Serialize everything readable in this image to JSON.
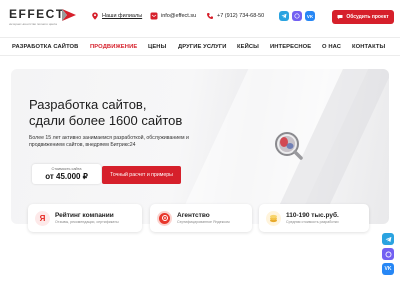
{
  "header": {
    "logo_text": "EFFECT",
    "logo_tagline": "интернет-агентство полного цикла",
    "filials_label": "Наши филиалы",
    "email": "info@effect.su",
    "phone": "+7 (912) 734-68-50",
    "discuss_label": "Обсудить проект",
    "socials": [
      "telegram-icon",
      "viber-icon",
      "vk-icon"
    ]
  },
  "nav": {
    "items": [
      {
        "label": "РАЗРАБОТКА САЙТОВ",
        "active": false
      },
      {
        "label": "ПРОДВИЖЕНИЕ",
        "active": true
      },
      {
        "label": "ЦЕНЫ",
        "active": false
      },
      {
        "label": "ДРУГИЕ УСЛУГИ",
        "active": false
      },
      {
        "label": "КЕЙСЫ",
        "active": false
      },
      {
        "label": "ИНТЕРЕСНОЕ",
        "active": false
      },
      {
        "label": "О НАС",
        "active": false
      },
      {
        "label": "КОНТАКТЫ",
        "active": false
      }
    ]
  },
  "hero": {
    "title_line1": "Разработка сайтов,",
    "title_line2": "сдали более 1600 сайтов",
    "description": "Более 15 лет активно занимаемся разработкой, обслуживанием и продвижением сайтов, внедряем Битрикс24",
    "price_caption": "Стоимость сайта",
    "price_value": "от 45.000 ₽",
    "calc_button": "Точный расчет и примеры"
  },
  "features": [
    {
      "title": "Рейтинг компании",
      "subtitle": "Отзывы, рекомендации, сертификаты",
      "icon": "yandex-icon"
    },
    {
      "title": "Агентство",
      "subtitle": "Сертифицированное Яндексом",
      "icon": "agency-badge-icon"
    },
    {
      "title": "110-190 тыс.руб.",
      "subtitle": "Средняя стоимость разработки",
      "icon": "coins-icon"
    }
  ],
  "colors": {
    "accent": "#d6202b",
    "telegram": "#2aa3e0",
    "viber": "#7360f2",
    "vk": "#2787f5"
  }
}
